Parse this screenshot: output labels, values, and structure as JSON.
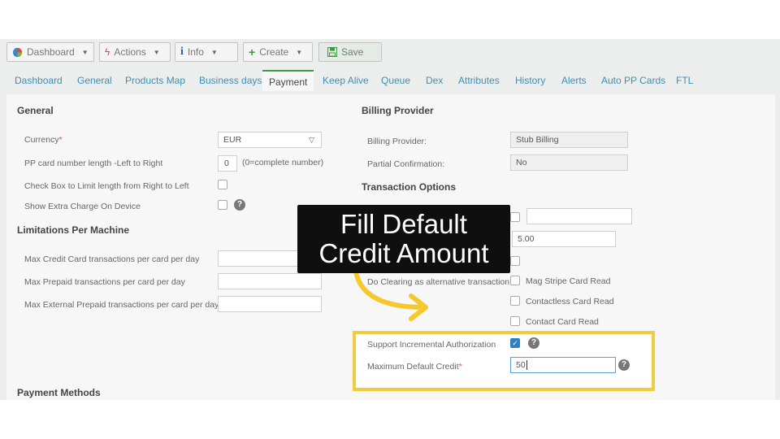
{
  "toolbar": {
    "dashboard": "Dashboard",
    "actions": "Actions",
    "info": "Info",
    "create": "Create",
    "save": "Save"
  },
  "tabs": [
    "Dashboard",
    "General",
    "Products Map",
    "Business days",
    "Payment",
    "Keep Alive",
    "Queue",
    "Dex",
    "Attributes",
    "History",
    "Alerts",
    "Auto PP Cards",
    "FTL"
  ],
  "general": {
    "title": "General",
    "currency_label": "Currency",
    "currency_value": "EUR",
    "pp_length_label": "PP card number length -Left to Right",
    "pp_length_value": "0",
    "pp_length_hint": "(0=complete number)",
    "check_box_label": "Check Box to Limit length from Right to Left",
    "extra_charge_label": "Show Extra Charge On Device"
  },
  "limitations": {
    "title": "Limitations Per Machine",
    "credit_label": "Max Credit Card transactions per card per day",
    "prepaid_label": "Max Prepaid transactions per card per day",
    "external_label": "Max External Prepaid transactions per card per day"
  },
  "billing": {
    "title": "Billing Provider",
    "provider_label": "Billing Provider:",
    "provider_value": "Stub Billing",
    "partial_label": "Partial Confirmation:",
    "partial_value": "No"
  },
  "transaction": {
    "title": "Transaction Options",
    "amount_value": "5.00",
    "clearing_label": "Do Clearing as alternative transaction",
    "mag_stripe": "Mag Stripe Card Read",
    "contactless": "Contactless Card Read",
    "contact": "Contact Card Read",
    "incremental_label": "Support Incremental Authorization",
    "max_credit_label": "Maximum Default Credit",
    "max_credit_value": "50"
  },
  "payment_methods": {
    "title": "Payment Methods"
  },
  "overlay": {
    "line1": "Fill Default",
    "line2": "Credit Amount"
  },
  "colors": {
    "highlight": "#f2cc3c",
    "link": "#3f8fb3",
    "active_tab": "#3a9a40",
    "checkbox": "#2f7fc1"
  }
}
